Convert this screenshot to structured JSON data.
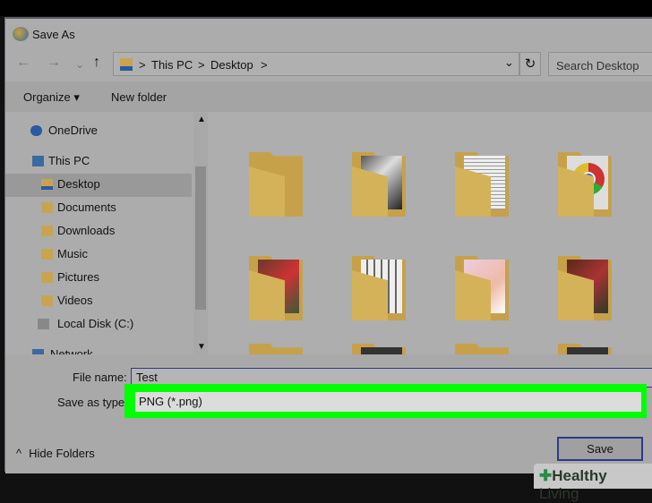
{
  "window": {
    "title": "Save As"
  },
  "nav": {
    "back": "←",
    "forward": "→",
    "recent": "⌄",
    "up": "↑"
  },
  "address": {
    "sep": ">",
    "crumbs": [
      "This PC",
      "Desktop"
    ],
    "dropdown": "⌄",
    "refresh": "↻"
  },
  "search": {
    "placeholder": "Search Desktop"
  },
  "toolbar": {
    "organize": "Organize ▾",
    "new_folder": "New folder"
  },
  "sidebar": {
    "items": [
      {
        "label": "OneDrive"
      },
      {
        "label": "This PC"
      },
      {
        "label": "Desktop",
        "selected": true
      },
      {
        "label": "Documents"
      },
      {
        "label": "Downloads"
      },
      {
        "label": "Music"
      },
      {
        "label": "Pictures"
      },
      {
        "label": "Videos"
      },
      {
        "label": "Local Disk (C:)"
      },
      {
        "label": "Network"
      }
    ]
  },
  "form": {
    "file_name_label": "File name:",
    "file_name": "Test",
    "type_label": "Save as type:",
    "type_value": "PNG (*.png)"
  },
  "buttons": {
    "save": "Save",
    "hide_folders": "Hide Folders",
    "hide_icon": "^"
  },
  "watermark": {
    "text_bold": "Healthy",
    "text": "Living"
  },
  "colors": {
    "highlight": "#00ff00",
    "accent": "#2c3a8c"
  }
}
